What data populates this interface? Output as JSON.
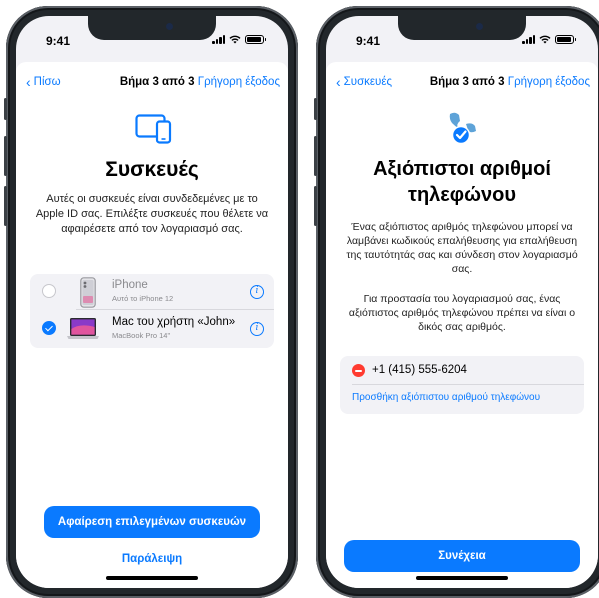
{
  "status": {
    "time": "9:41"
  },
  "left": {
    "nav": {
      "back_label": "Πίσω",
      "step_label": "Βήμα 3 από 3",
      "quick_exit_label": "Γρήγορη έξοδος"
    },
    "title": "Συσκευές",
    "description": "Αυτές οι συσκευές είναι συνδεδεμένες με το Apple ID σας. Επιλέξτε συσκευές που θέλετε να αφαιρέσετε από τον λογαριασμό σας.",
    "devices": [
      {
        "name": "iPhone",
        "subtitle": "Αυτό το iPhone 12",
        "selected": false,
        "icon": "iphone-icon"
      },
      {
        "name": "Mac του χρήστη «John»",
        "subtitle": "MacBook Pro 14\"",
        "selected": true,
        "icon": "macbook-icon"
      }
    ],
    "remove_button_label": "Αφαίρεση επιλεγμένων συσκευών",
    "skip_label": "Παράλειψη"
  },
  "right": {
    "nav": {
      "back_label": "Συσκευές",
      "step_label": "Βήμα 3 από 3",
      "quick_exit_label": "Γρήγορη έξοδος"
    },
    "title_line1": "Αξιόπιστοι αριθμοί",
    "title_line2": "τηλεφώνου",
    "description1": "Ένας αξιόπιστος αριθμός τηλεφώνου μπορεί να λαμβάνει κωδικούς επαλήθευσης για επαλήθευση της ταυτότητάς σας και σύνδεση στον λογαριασμό σας.",
    "description2": "Για προστασία του λογαριασμού σας, ένας αξιόπιστος αριθμός τηλεφώνου πρέπει να είναι ο δικός σας αριθμός.",
    "phone_number": "+1 (415) 555-6204",
    "add_number_label": "Προσθήκη αξιόπιστου αριθμού τηλεφώνου",
    "continue_label": "Συνέχεια"
  },
  "colors": {
    "accent": "#0a7aff",
    "remove": "#ff3b30",
    "frame": "#22272b"
  }
}
